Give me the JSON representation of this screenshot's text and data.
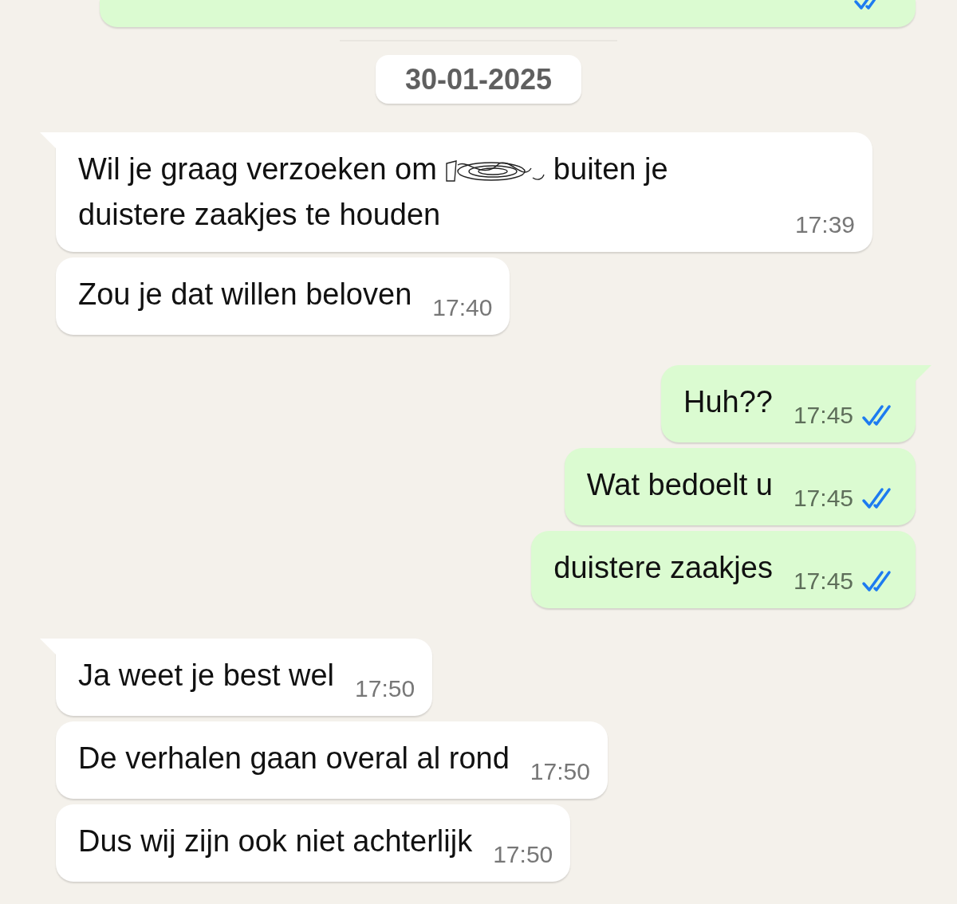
{
  "previous_message": {
    "kind": "outgoing",
    "read": true
  },
  "date_chip": "30-01-2025",
  "messages": [
    {
      "kind": "incoming",
      "tail": true,
      "text": "Wil je graag verzoeken om",
      "redacted": true,
      "text_after": "buiten je duistere zaakjes te houden",
      "time": "17:39"
    },
    {
      "kind": "incoming",
      "tail": false,
      "text": "Zou je dat willen beloven",
      "time": "17:40"
    },
    {
      "kind": "outgoing",
      "tail": true,
      "text": "Huh??",
      "time": "17:45",
      "read": true
    },
    {
      "kind": "outgoing",
      "tail": false,
      "text": "Wat bedoelt u",
      "time": "17:45",
      "read": true
    },
    {
      "kind": "outgoing",
      "tail": false,
      "text": "duistere zaakjes",
      "time": "17:45",
      "read": true
    },
    {
      "kind": "incoming",
      "tail": true,
      "text": "Ja weet je best wel",
      "time": "17:50"
    },
    {
      "kind": "incoming",
      "tail": false,
      "text": "De verhalen gaan overal al rond",
      "time": "17:50"
    },
    {
      "kind": "incoming",
      "tail": false,
      "text": "Dus wij zijn ook niet achterlijk",
      "time": "17:50"
    }
  ]
}
